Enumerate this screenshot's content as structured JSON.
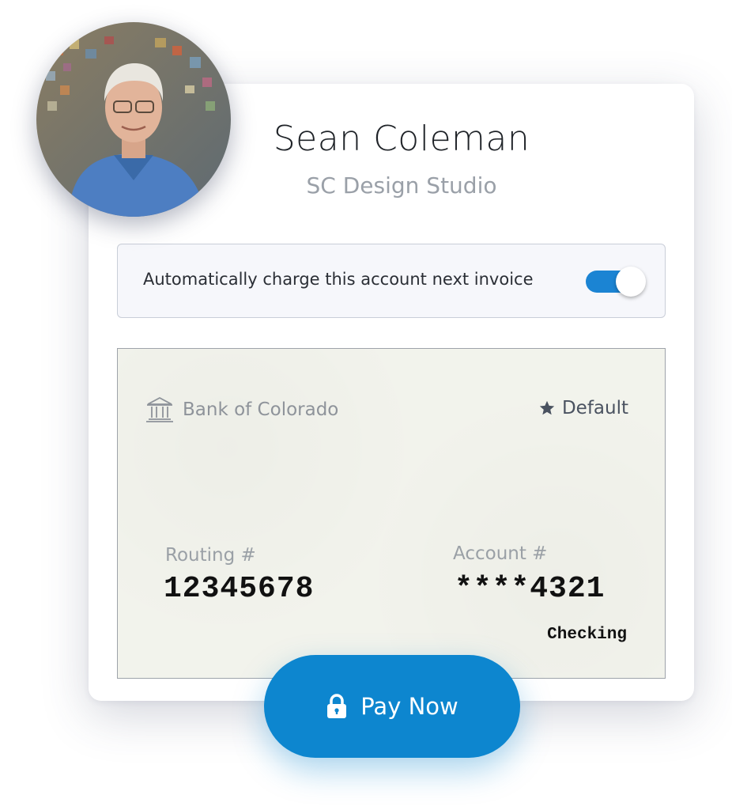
{
  "profile": {
    "name": "Sean Coleman",
    "company": "SC Design Studio",
    "avatar_icon": "user-photo"
  },
  "autocharge": {
    "label": "Automatically charge this account next invoice",
    "enabled": true,
    "accent_color": "#1b84d3"
  },
  "bank_account": {
    "bank_icon": "bank-icon",
    "bank_name": "Bank of Colorado",
    "default_icon": "star-icon",
    "default_label": "Default",
    "routing_label": "Routing #",
    "routing_number": "12345678",
    "account_label": "Account #",
    "account_number": "****4321",
    "account_type": "Checking"
  },
  "pay_button": {
    "icon": "lock-icon",
    "label": "Pay Now",
    "color": "#0d86cf"
  }
}
